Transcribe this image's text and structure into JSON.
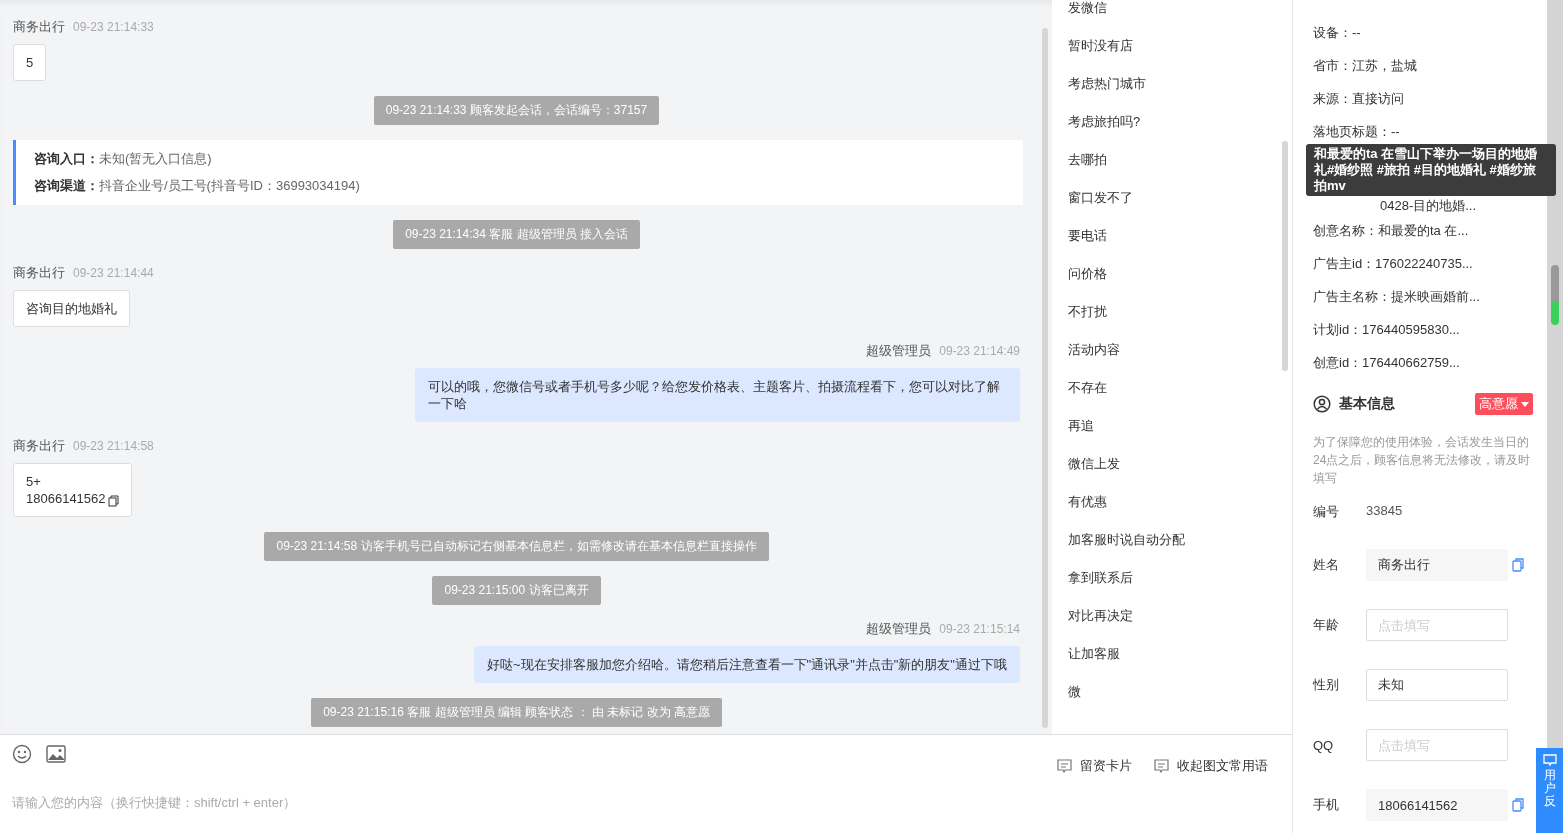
{
  "messages": [
    {
      "kind": "customer",
      "sender": "商务出行",
      "time": "09-23 21:14:33",
      "text": "5",
      "copyable": false
    },
    {
      "kind": "system",
      "text": "09-23 21:14:33 顾客发起会话，会话编号：37157"
    },
    {
      "kind": "info",
      "rows": [
        {
          "label": "咨询入口：",
          "value": "未知(暂无入口信息)"
        },
        {
          "label": "咨询渠道：",
          "value": "抖音企业号/员工号(抖音号ID：36993034194)"
        }
      ]
    },
    {
      "kind": "system",
      "text": "09-23 21:14:34 客服 超级管理员 接入会话"
    },
    {
      "kind": "customer",
      "sender": "商务出行",
      "time": "09-23 21:14:44",
      "text": "咨询目的地婚礼",
      "copyable": false
    },
    {
      "kind": "agent",
      "sender": "超级管理员",
      "time": "09-23 21:14:49",
      "text": "可以的哦，您微信号或者手机号多少呢？给您发价格表、主题客片、拍摄流程看下，您可以对比了解一下哈"
    },
    {
      "kind": "customer",
      "sender": "商务出行",
      "time": "09-23 21:14:58",
      "text": "5+\n18066141562",
      "copyable": true
    },
    {
      "kind": "system",
      "text": "09-23 21:14:58 访客手机号已自动标记右侧基本信息栏，如需修改请在基本信息栏直接操作"
    },
    {
      "kind": "system",
      "text": "09-23 21:15:00 访客已离开"
    },
    {
      "kind": "agent",
      "sender": "超级管理员",
      "time": "09-23 21:15:14",
      "text": "好哒~现在安排客服加您介绍哈。请您稍后注意查看一下\"通讯录\"并点击\"新的朋友\"通过下哦"
    },
    {
      "kind": "system",
      "text": "09-23 21:15:16 客服 超级管理员 编辑 顾客状态 ： 由 未标记 改为 高意愿"
    }
  ],
  "quick_replies": [
    "发微信",
    "暂时没有店",
    "考虑热门城市",
    "考虑旅拍吗?",
    "去哪拍",
    "窗口发不了",
    "要电话",
    "问价格",
    "不打扰",
    "活动内容",
    "不存在",
    "再追",
    "微信上发",
    "有优惠",
    "加客服时说自动分配",
    "拿到联系后",
    "对比再决定",
    "让加客服",
    "微"
  ],
  "composer": {
    "placeholder": "请输入您的内容（换行快捷键：shift/ctrl + enter）",
    "actions": [
      "留资卡片",
      "收起图文常用语"
    ]
  },
  "visit_info": {
    "rows": [
      "设备：--",
      "省市：江苏，盐城",
      "来源：直接访问",
      "落地页标题：--"
    ],
    "tooltip": "和最爱的ta 在雪山下举办一场目的地婚礼#婚纱照 #旅拍 #目的地婚礼 #婚纱旅拍mv",
    "rows_below": [
      "0428-目的地婚...",
      "创意名称：和最爱的ta 在...",
      "广告主id：176022240735...",
      "广告主名称：提米映画婚前...",
      "计划id：176440595830...",
      "创意id：176440662759..."
    ]
  },
  "basic_info": {
    "title": "基本信息",
    "intent": "高意愿",
    "notice": "为了保障您的使用体验，会话发生当日的24点之后，顾客信息将无法修改，请及时填写",
    "id_label": "编号",
    "id_value": "33845",
    "fields": [
      {
        "label": "姓名",
        "value": "商务出行",
        "readonly": true,
        "copyable": true
      },
      {
        "label": "年龄",
        "placeholder": "点击填写",
        "readonly": false,
        "copyable": false
      },
      {
        "label": "性别",
        "value": "未知",
        "readonly": false,
        "copyable": false
      },
      {
        "label": "QQ",
        "placeholder": "点击填写",
        "readonly": false,
        "copyable": false
      },
      {
        "label": "手机",
        "value": "18066141562",
        "readonly": true,
        "copyable": true
      }
    ]
  },
  "feedback": "用户反"
}
